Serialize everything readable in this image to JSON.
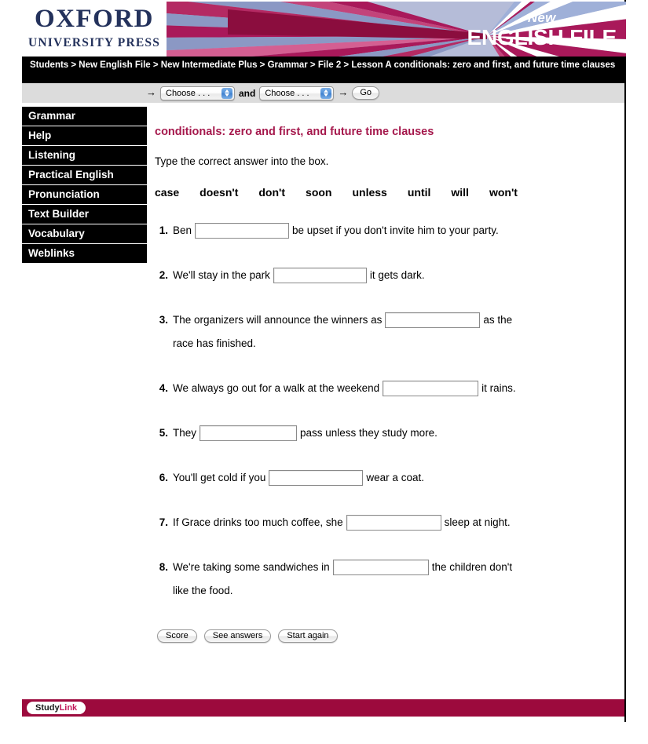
{
  "brand": {
    "publisher_line1": "OXFORD",
    "publisher_line2": "UNIVERSITY PRESS",
    "product_new": "New",
    "product_name": "ENGLISH FILE",
    "title_color": "#a5184c",
    "footer_color": "#9c0a3d",
    "publisher_color": "#24325c"
  },
  "breadcrumb": {
    "text": "Students > New English File > New Intermediate Plus > Grammar > File 2 > Lesson A conditionals: zero and first, and future time clauses"
  },
  "toolbar": {
    "arrow_left": "→",
    "select_1": {
      "value": "Choose . . .",
      "options": [
        "Choose . . ."
      ]
    },
    "conjunction": "and",
    "select_2": {
      "value": "Choose . . .",
      "options": [
        "Choose . . ."
      ]
    },
    "arrow_right": "→",
    "go_label": "Go"
  },
  "sidebar": {
    "items": [
      {
        "label": "Grammar"
      },
      {
        "label": "Help"
      },
      {
        "label": "Listening"
      },
      {
        "label": "Practical English"
      },
      {
        "label": "Pronunciation"
      },
      {
        "label": "Text Builder"
      },
      {
        "label": "Vocabulary"
      },
      {
        "label": "Weblinks"
      }
    ]
  },
  "exercise": {
    "title": "conditionals: zero and first, and future time clauses",
    "instruction": "Type the correct answer into the box.",
    "word_bank": [
      "case",
      "doesn't",
      "don't",
      "soon",
      "unless",
      "until",
      "will",
      "won't"
    ],
    "questions": [
      {
        "number": "1.",
        "before": "Ben",
        "input_value": "",
        "input_width": 120,
        "after": "be upset if you don't invite him to your party.",
        "second_line": ""
      },
      {
        "number": "2.",
        "before": "We'll stay in the park",
        "input_value": "",
        "input_width": 119,
        "after": "it gets dark.",
        "second_line": ""
      },
      {
        "number": "3.",
        "before": "The organizers will announce the winners as",
        "input_value": "",
        "input_width": 121,
        "after": "as the",
        "second_line": "race has finished."
      },
      {
        "number": "4.",
        "before": "We always go out for a walk at the weekend",
        "input_value": "",
        "input_width": 122,
        "after": "it rains.",
        "second_line": ""
      },
      {
        "number": "5.",
        "before": "They",
        "input_value": "",
        "input_width": 124,
        "after": "pass unless they study more.",
        "second_line": ""
      },
      {
        "number": "6.",
        "before": "You'll get cold if you",
        "input_value": "",
        "input_width": 120,
        "after": "wear a coat.",
        "second_line": ""
      },
      {
        "number": "7.",
        "before": "If Grace drinks too much coffee, she",
        "input_value": "",
        "input_width": 121,
        "after": "sleep at night.",
        "second_line": ""
      },
      {
        "number": "8.",
        "before": "We're taking some sandwiches in",
        "input_value": "",
        "input_width": 122,
        "after": "the children don't",
        "second_line": "like the food."
      }
    ],
    "buttons": [
      {
        "label": "Score"
      },
      {
        "label": "See answers"
      },
      {
        "label": "Start again"
      }
    ]
  },
  "footer": {
    "studylink_part1": "Study",
    "studylink_part2": "Link"
  }
}
